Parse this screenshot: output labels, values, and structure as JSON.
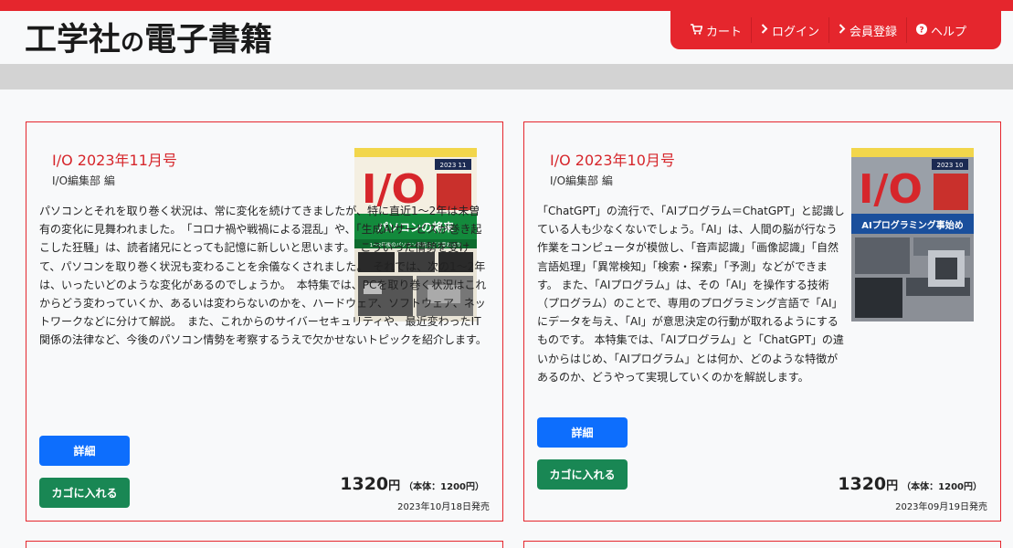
{
  "header": {
    "logo_main": "工学社",
    "logo_no": "の",
    "logo_tail": "電子書籍"
  },
  "nav": [
    {
      "icon": "cart-icon",
      "label": "カート"
    },
    {
      "icon": "chevron-right-icon",
      "label": "ログイン"
    },
    {
      "icon": "chevron-right-icon",
      "label": "会員登録"
    },
    {
      "icon": "question-circle-icon",
      "label": "ヘルプ"
    }
  ],
  "products": [
    {
      "title": "I/O 2023年11月号",
      "author": "I/O編集部 編",
      "description": "パソコンとそれを取り巻く状況は、常に変化を続けてきましたが、特に直近1〜2年は未曽有の変化に見舞われました。　「コロナ禍や戦禍による混乱」や、「生成AIサービスが巻き起こした狂騒」は、読者諸兄にとっても記憶に新しいと思います。　こういった情勢を受けて、パソコンを取り巻く状況も変わることを余儀なくされました。　それでは、次の1〜2年は、いったいどのような変化があるのでしょうか。　本特集では、PCを取り巻く状況はこれからどう変わっていくか、あるいは変わらないのかを、ハードウェア、ソフトウェア、ネットワークなどに分けて解説。　また、これからのサイバーセキュリティや、最近変わったIT関係の法律など、今後のパソコン情勢を考察するうえで欠かせないトピックを紹介します。",
      "detail_label": "詳細",
      "cart_label": "カゴに入れる",
      "price": "1320",
      "yen": "円",
      "price_note": "（本体：1200円）",
      "release": "2023年10月18日発売",
      "cover": {
        "badge": "2023 11",
        "logo": "I/O",
        "headline": "パソコンの将来",
        "sub": "1〜2年後のパソコン事情はどう変わるか"
      }
    },
    {
      "title": "I/O 2023年10月号",
      "author": "I/O編集部 編",
      "description": "「ChatGPT」の流行で、「AIプログラム＝ChatGPT」と認識している人も少なくないでしょう。「AI」は、人間の脳が行なう作業をコンピュータが模倣し、「音声認識」「画像認識」「自然言語処理」「異常検知」「検索・探索」「予測」などができます。 また、「AIプログラム」は、その「AI」を操作する技術（プログラム）のことで、専用のプログラミング言語で「AI」にデータを与え、「AI」が意思決定の行動が取れるようにするものです。 本特集では、「AIプログラム」と「ChatGPT」の違いからはじめ、「AIプログラム」とは何か、どのような特徴があるのか、どうやって実現していくのかを解説します。",
      "detail_label": "詳細",
      "cart_label": "カゴに入れる",
      "price": "1320",
      "yen": "円",
      "price_note": "（本体：1200円）",
      "release": "2023年09月19日発売",
      "cover": {
        "badge": "2023 10",
        "logo": "I/O",
        "headline": "AIプログラミング事始め"
      }
    }
  ],
  "colors": {
    "brand_red": "#e5262d",
    "primary": "#0d6efd",
    "success": "#198754"
  }
}
